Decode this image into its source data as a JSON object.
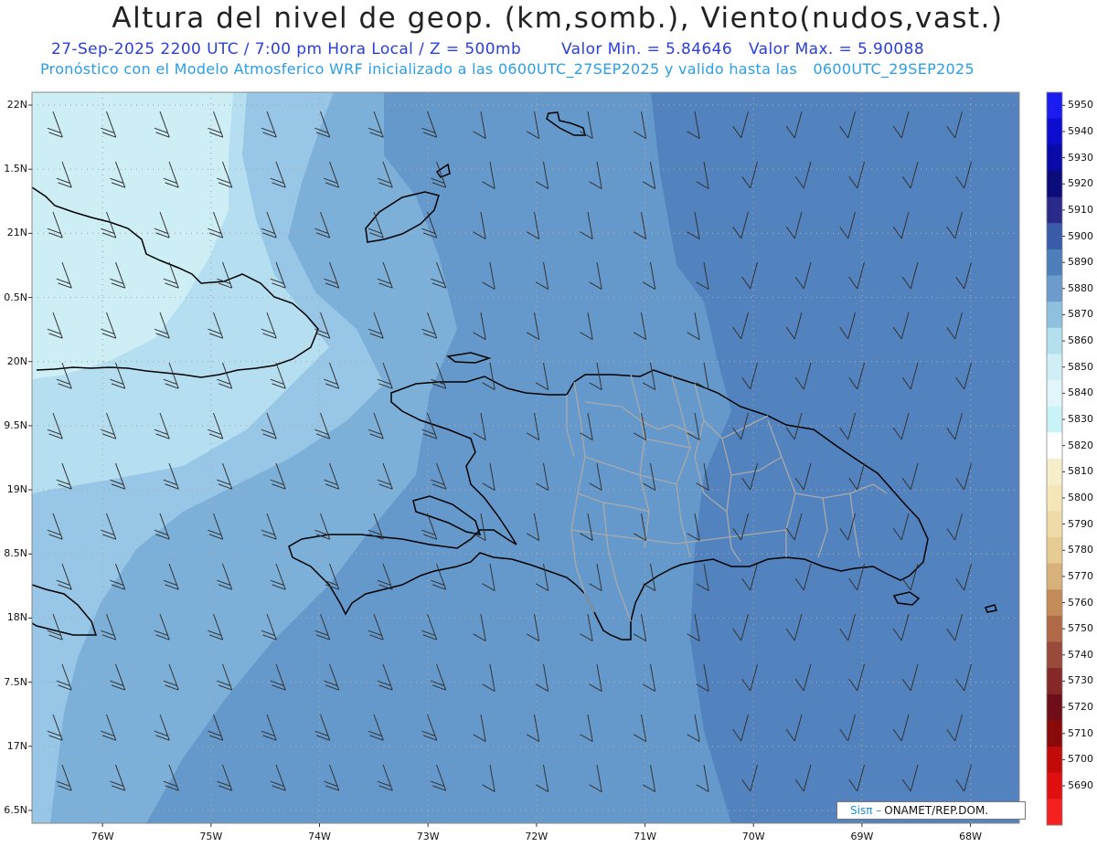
{
  "header": {
    "title": "Altura del nivel de geop. (km,somb.), Viento(nudos,vast.)",
    "datetime": "27-Sep-2025  2200 UTC / 7:00 pm Hora Local / Z = 500mb",
    "min_label": "Valor Min. = 5.84646",
    "max_label": "Valor Max. = 5.90088",
    "forecast_line": "Pronóstico con el Modelo Atmosferico WRF inicializado a las 0600UTC_27SEP2025 y valido hasta las",
    "valid_until": "0600UTC_29SEP2025"
  },
  "axes": {
    "lat_labels": [
      "22N",
      "1.5N",
      "21N",
      "0.5N",
      "20N",
      "9.5N",
      "19N",
      "8.5N",
      "18N",
      "7.5N",
      "17N",
      "6.5N"
    ],
    "lat_values": [
      22,
      21.5,
      21,
      20.5,
      20,
      19.5,
      19,
      18.5,
      18,
      17.5,
      17,
      16.5
    ],
    "lon_labels": [
      "76W",
      "75W",
      "74W",
      "73W",
      "72W",
      "71W",
      "70W",
      "69W",
      "68W"
    ],
    "lon_values": [
      -76,
      -75,
      -74,
      -73,
      -72,
      -71,
      -70,
      -69,
      -68
    ],
    "lon_range": [
      -76.65,
      -67.55
    ],
    "lat_range": [
      16.4,
      22.1
    ]
  },
  "colorbar": {
    "levels": [
      "5950",
      "5940",
      "5930",
      "5920",
      "5910",
      "5900",
      "5890",
      "5880",
      "5870",
      "5860",
      "5850",
      "5840",
      "5830",
      "5820",
      "5810",
      "5800",
      "5790",
      "5780",
      "5770",
      "5760",
      "5750",
      "5740",
      "5730",
      "5720",
      "5710",
      "5700",
      "5690"
    ],
    "colors": [
      "#1a1cf0",
      "#0d0dd0",
      "#0a0aa8",
      "#0b0b7a",
      "#2a2a8a",
      "#3a5aaa",
      "#4e7fba",
      "#6c9bcc",
      "#8ec0e0",
      "#b4e0ee",
      "#cfeef6",
      "#e0f6fa",
      "#c8f4f8",
      "#ffffff",
      "#f7eecb",
      "#f5e6b8",
      "#efdba8",
      "#e6cc92",
      "#d8b07a",
      "#c48c58",
      "#b06a48",
      "#9a4a3a",
      "#862828",
      "#700d1a",
      "#8a0a0a",
      "#c20a0a",
      "#e01010",
      "#f52020"
    ]
  },
  "field": {
    "colors": {
      "c5840": "#cdeef5",
      "c5850": "#b5dff0",
      "c5860": "#97c6e6",
      "c5870": "#7db0d9",
      "c5880": "#6599cb",
      "c5890": "#5283bf"
    },
    "contour_ideas": "bands increase eastward"
  },
  "map_style": {
    "coast_color": "#000000",
    "province_color": "#a9a9a9",
    "grid_color": "#aaaaaa",
    "barb_color": "#333333"
  },
  "credit": {
    "brand": "Sisπ –",
    "org": "ONAMET/REP.DOM."
  }
}
